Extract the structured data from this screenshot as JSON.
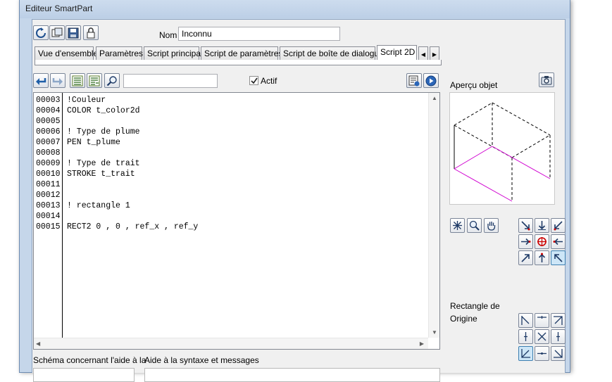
{
  "window": {
    "title": "Editeur SmartPart"
  },
  "header": {
    "name_label": "Nom",
    "name_value": "Inconnu"
  },
  "toolbar": {
    "buttons": [
      "refresh-icon",
      "copy-icon",
      "save-icon",
      "open-icon"
    ]
  },
  "tabs": [
    {
      "label": "Vue d'ensemble"
    },
    {
      "label": "Paramètres"
    },
    {
      "label": "Script principal"
    },
    {
      "label": "Script de paramètres"
    },
    {
      "label": "Script de boîte de dialogue"
    },
    {
      "label": "Script 2D"
    }
  ],
  "editor_toolbar": {
    "search_value": "",
    "active_label": "Actif",
    "active_checked": true
  },
  "code_lines": [
    {
      "num": "00003",
      "text": "!Couleur"
    },
    {
      "num": "00004",
      "text": "COLOR t_color2d"
    },
    {
      "num": "00005",
      "text": ""
    },
    {
      "num": "00006",
      "text": "! Type de plume"
    },
    {
      "num": "00007",
      "text": "PEN t_plume"
    },
    {
      "num": "00008",
      "text": ""
    },
    {
      "num": "00009",
      "text": "! Type de trait"
    },
    {
      "num": "00010",
      "text": "STROKE t_trait"
    },
    {
      "num": "00011",
      "text": ""
    },
    {
      "num": "00012",
      "text": ""
    },
    {
      "num": "00013",
      "text": "! rectangle 1"
    },
    {
      "num": "00014",
      "text": ""
    },
    {
      "num": "00015",
      "text": "RECT2 0 , 0 , ref_x , ref_y"
    }
  ],
  "preview": {
    "label": "Aperçu objet"
  },
  "origin": {
    "label_line1": "Rectangle de",
    "label_line2": "Origine"
  },
  "bottom": {
    "schema_label": "Schéma concernant l'aide à la",
    "syntax_label": "Aide à la syntaxe et messages"
  },
  "colors": {
    "accent": "#c5d6ea",
    "preview_magenta": "#d000d0"
  }
}
